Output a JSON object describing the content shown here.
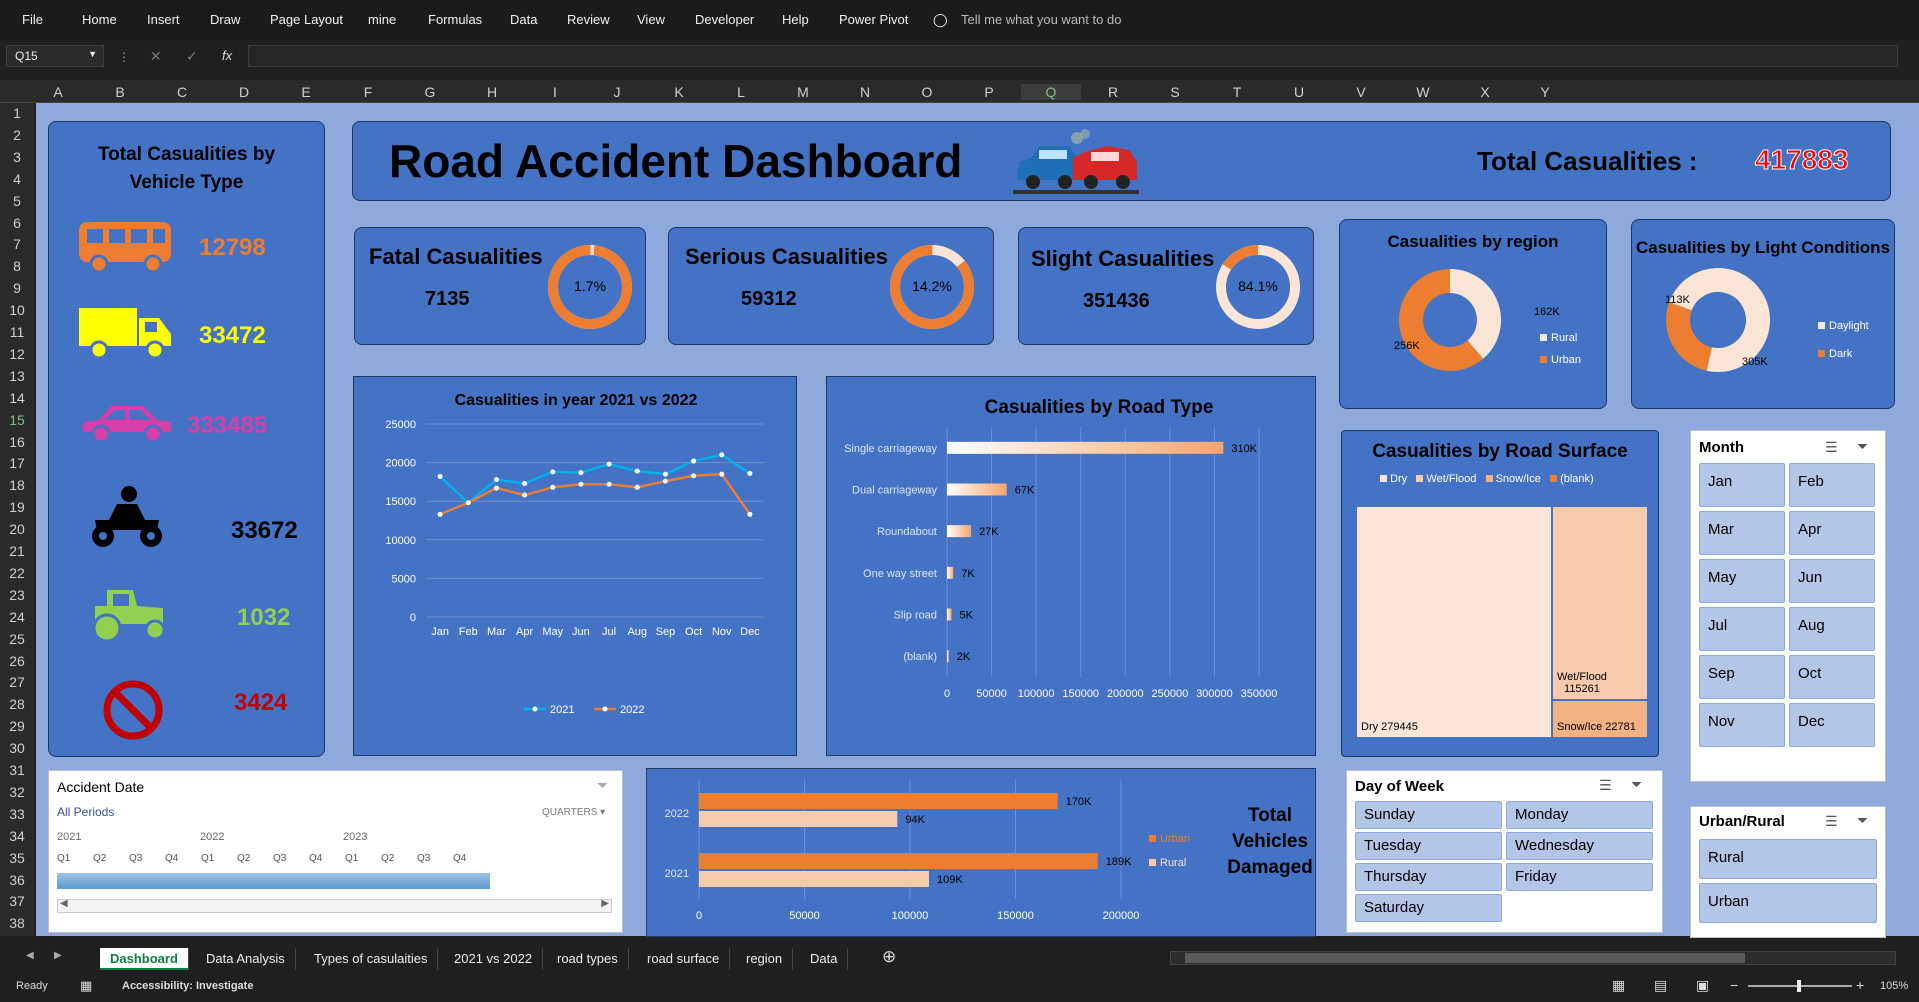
{
  "ribbon": {
    "menu": [
      "File",
      "Home",
      "Insert",
      "Draw",
      "Page Layout",
      "mine",
      "Formulas",
      "Data",
      "Review",
      "View",
      "Developer",
      "Help",
      "Power Pivot"
    ],
    "tell_me": "Tell me what you want to do"
  },
  "formula_bar": {
    "cell_ref": "Q15",
    "fx": "fx",
    "value": ""
  },
  "columns": [
    "A",
    "B",
    "C",
    "D",
    "E",
    "F",
    "G",
    "H",
    "I",
    "J",
    "K",
    "L",
    "M",
    "N",
    "O",
    "P",
    "Q",
    "R",
    "S",
    "T",
    "U",
    "V",
    "W",
    "X",
    "Y"
  ],
  "rows": [
    "1",
    "2",
    "3",
    "4",
    "5",
    "6",
    "7",
    "8",
    "9",
    "10",
    "11",
    "12",
    "13",
    "14",
    "15",
    "16",
    "17",
    "18",
    "19",
    "20",
    "21",
    "22",
    "23",
    "24",
    "25",
    "26",
    "27",
    "28",
    "29",
    "30",
    "31",
    "32",
    "33",
    "34",
    "35",
    "36",
    "37",
    "38"
  ],
  "dashboard": {
    "title": "Road Accident Dashboard",
    "total_label": "Total Casualities :",
    "total_value": "417883"
  },
  "vehicle_panel": {
    "title_line1": "Total Casualities by",
    "title_line2": "Vehicle Type",
    "items": [
      {
        "icon": "bus-icon",
        "value": "12798",
        "color": "#ed7d31"
      },
      {
        "icon": "truck-icon",
        "value": "33472",
        "color": "#ffff00"
      },
      {
        "icon": "car-icon",
        "value": "333485",
        "color": "#d63ea8"
      },
      {
        "icon": "motorcycle-icon",
        "value": "33672",
        "color": "#000000"
      },
      {
        "icon": "tractor-icon",
        "value": "1032",
        "color": "#92d050"
      },
      {
        "icon": "no-entry-icon",
        "value": "3424",
        "color": "#c00000"
      }
    ]
  },
  "kpis": [
    {
      "label": "Fatal Casualities",
      "value": "7135",
      "pct": "1.7%",
      "fraction": 0.017
    },
    {
      "label": "Serious Casualities",
      "value": "59312",
      "pct": "14.2%",
      "fraction": 0.142
    },
    {
      "label": "Slight Casualities",
      "value": "351436",
      "pct": "84.1%",
      "fraction": 0.841
    }
  ],
  "region_panel": {
    "title": "Casualities by region",
    "labels": [
      "162K",
      "256K"
    ],
    "legend": [
      "Rural",
      "Urban"
    ]
  },
  "light_panel": {
    "title": "Casualities by Light Conditions",
    "labels": [
      "113K",
      "305K"
    ],
    "legend": [
      "Daylight",
      "Dark"
    ]
  },
  "road_surface": {
    "title": "Casualities by Road Surface",
    "legend": [
      "Dry",
      "Wet/Flood",
      "Snow/Ice",
      "(blank)"
    ],
    "labels": {
      "dry": "Dry 279445",
      "wet_name": "Wet/Flood",
      "wet_value": "115261",
      "snow": "Snow/Ice 22781"
    }
  },
  "month_slicer": {
    "title": "Month",
    "items": [
      "Jan",
      "Feb",
      "Mar",
      "Apr",
      "May",
      "Jun",
      "Jul",
      "Aug",
      "Sep",
      "Oct",
      "Nov",
      "Dec"
    ]
  },
  "urban_slicer": {
    "title": "Urban/Rural",
    "items": [
      "Rural",
      "Urban"
    ]
  },
  "dow_slicer": {
    "title": "Day of Week",
    "items": [
      "Sunday",
      "Monday",
      "Tuesday",
      "Wednesday",
      "Thursday",
      "Friday",
      "Saturday"
    ]
  },
  "timeline": {
    "title": "Accident Date",
    "period": "All Periods",
    "unit": "QUARTERS",
    "years": [
      "2021",
      "2022",
      "2023"
    ],
    "quarters": [
      "Q1",
      "Q2",
      "Q3",
      "Q4",
      "Q1",
      "Q2",
      "Q3",
      "Q4",
      "Q1",
      "Q2",
      "Q3",
      "Q4"
    ]
  },
  "vehicles_damaged": {
    "title_lines": [
      "Total",
      "Vehicles",
      "Damaged"
    ]
  },
  "sheet_tabs": [
    "Dashboard",
    "Data Analysis",
    "Types of casulaities",
    "2021 vs 2022",
    "road types",
    "road surface",
    "region",
    "Data"
  ],
  "status": {
    "ready": "Ready",
    "accessibility": "Accessibility: Investigate",
    "zoom": "105%"
  },
  "chart_data": [
    {
      "type": "line",
      "title": "Casualities in year 2021 vs 2022",
      "categories": [
        "Jan",
        "Feb",
        "Mar",
        "Apr",
        "May",
        "Jun",
        "Jul",
        "Aug",
        "Sep",
        "Oct",
        "Nov",
        "Dec"
      ],
      "series": [
        {
          "name": "2021",
          "color": "#00b0f0",
          "values": [
            18200,
            14800,
            17800,
            17300,
            18800,
            18700,
            19800,
            18900,
            18500,
            20200,
            21000,
            18600
          ]
        },
        {
          "name": "2022",
          "color": "#ed7d31",
          "values": [
            13300,
            14800,
            16700,
            15800,
            16800,
            17200,
            17200,
            16800,
            17600,
            18300,
            18500,
            13300
          ]
        }
      ],
      "ylim": [
        0,
        25000
      ],
      "yticks": [
        0,
        5000,
        10000,
        15000,
        20000,
        25000
      ],
      "grid": true,
      "legend": "bottom"
    },
    {
      "type": "bar",
      "orientation": "horizontal",
      "title": "Casualities by Road Type",
      "categories": [
        "Single carriageway",
        "Dual carriageway",
        "Roundabout",
        "One way street",
        "Slip road",
        "(blank)"
      ],
      "values": [
        310000,
        67000,
        27000,
        7000,
        5000,
        2000
      ],
      "data_labels": [
        "310K",
        "67K",
        "27K",
        "7K",
        "5K",
        "2K"
      ],
      "xlim": [
        0,
        350000
      ],
      "xticks": [
        0,
        50000,
        100000,
        150000,
        200000,
        250000,
        300000,
        350000
      ],
      "grid": true
    },
    {
      "type": "bar",
      "orientation": "horizontal",
      "categories": [
        "2022",
        "2021"
      ],
      "series": [
        {
          "name": "Urban",
          "color": "#ed7d31",
          "values": [
            170000,
            189000
          ],
          "data_labels": [
            "170K",
            "189K"
          ]
        },
        {
          "name": "Rural",
          "color": "#f8cbad",
          "values": [
            94000,
            109000
          ],
          "data_labels": [
            "94K",
            "109K"
          ]
        }
      ],
      "xlim": [
        0,
        200000
      ],
      "xticks": [
        0,
        50000,
        100000,
        150000,
        200000
      ],
      "grid": true,
      "legend": "right"
    },
    {
      "type": "pie",
      "title": "Casualities by region",
      "categories": [
        "Rural",
        "Urban"
      ],
      "values": [
        162000,
        256000
      ]
    },
    {
      "type": "pie",
      "title": "Casualities by Light Conditions",
      "categories": [
        "Daylight",
        "Dark"
      ],
      "values": [
        305000,
        113000
      ]
    },
    {
      "type": "heatmap",
      "title": "Casualities by Road Surface",
      "categories": [
        "Dry",
        "Wet/Flood",
        "Snow/Ice"
      ],
      "values": [
        279445,
        115261,
        22781
      ]
    }
  ]
}
